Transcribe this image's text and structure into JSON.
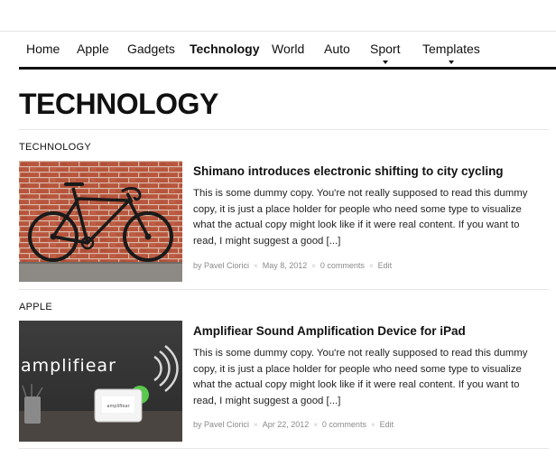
{
  "nav": {
    "items": [
      {
        "label": "Home",
        "active": false,
        "has_dropdown": false
      },
      {
        "label": "Apple",
        "active": false,
        "has_dropdown": false
      },
      {
        "label": "Gadgets",
        "active": false,
        "has_dropdown": false
      },
      {
        "label": "Technology",
        "active": true,
        "has_dropdown": false
      },
      {
        "label": "World",
        "active": false,
        "has_dropdown": false
      },
      {
        "label": "Auto",
        "active": false,
        "has_dropdown": false
      },
      {
        "label": "Sport",
        "active": false,
        "has_dropdown": true
      },
      {
        "label": "Templates",
        "active": false,
        "has_dropdown": true
      }
    ]
  },
  "page": {
    "title": "TECHNOLOGY"
  },
  "posts": [
    {
      "category": "TECHNOLOGY",
      "image": "bicycle-in-front-of-brick-wall",
      "title": "Shimano introduces electronic shifting to city cycling",
      "excerpt": "This is some dummy copy. You're not really supposed to read this dummy copy, it is just a place holder for people who need some type to visualize what the actual copy might look like if it were real content. If you want to read, I might suggest a good ",
      "read_more": "[...]",
      "author": "by Pavel Ciorici",
      "date": "May 8, 2012",
      "comments": "0 comments",
      "edit": "Edit"
    },
    {
      "category": "APPLE",
      "image": "amplifiear-device-on-desk",
      "image_text": "amplifiear",
      "title": "Amplifiear Sound Amplification Device for iPad",
      "excerpt": "This is some dummy copy. You're not really supposed to read this dummy copy, it is just a place holder for people who need some type to visualize what the actual copy might look like if it were real content. If you want to read, I might suggest a good ",
      "read_more": "[...]",
      "author": "by Pavel Ciorici",
      "date": "Apr 22, 2012",
      "comments": "0 comments",
      "edit": "Edit"
    }
  ],
  "colors": {
    "text": "#111111",
    "meta": "#8a8a8a",
    "rule": "#e6e6e6",
    "nav_rule": "#111111",
    "brick": "#b5503a",
    "ipad_green": "#58c94a"
  }
}
